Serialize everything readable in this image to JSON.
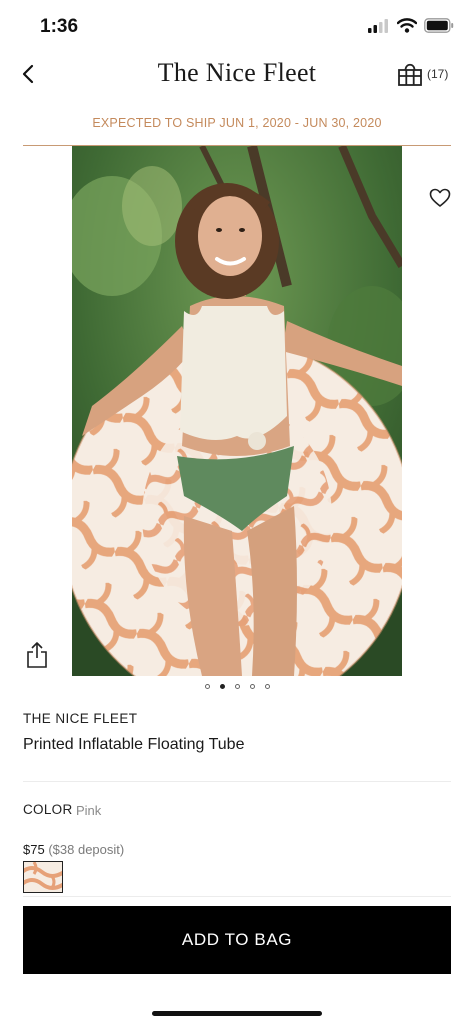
{
  "status_bar": {
    "time": "1:36"
  },
  "header": {
    "title": "The Nice Fleet",
    "bag_count": "(17)"
  },
  "shipping_notice": "EXPECTED TO SHIP JUN 1, 2020 - JUN 30, 2020",
  "carousel": {
    "slides": 5,
    "active_index": 1
  },
  "product": {
    "brand": "THE NICE FLEET",
    "name": "Printed Inflatable Floating Tube",
    "color_label": "COLOR",
    "color_value": "Pink",
    "price": "$75",
    "deposit": "($38 deposit)"
  },
  "add_to_bag_label": "ADD TO BAG",
  "colors": {
    "accent": "#c48a5c",
    "button": "#000000"
  }
}
